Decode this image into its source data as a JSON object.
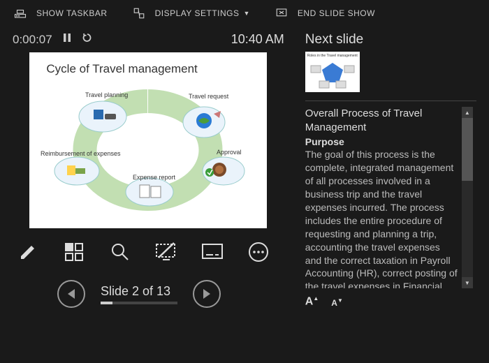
{
  "toolbar": {
    "show_taskbar": "SHOW TASKBAR",
    "display_settings": "DISPLAY SETTINGS",
    "end_slide_show": "END SLIDE SHOW"
  },
  "timer": {
    "elapsed": "0:00:07",
    "clock": "10:40 AM"
  },
  "slide": {
    "title": "Cycle of Travel management",
    "labels": {
      "travel_planning": "Travel planning",
      "travel_request": "Travel request",
      "approval": "Approval",
      "expense_report": "Expense report",
      "reimbursement": "Reimbursement of expenses"
    }
  },
  "nav": {
    "slide_label": "Slide 2 of 13",
    "current": 2,
    "total": 13
  },
  "next": {
    "heading": "Next slide",
    "thumb_title": "Roles in the Travel management"
  },
  "notes": {
    "title": "Overall Process of Travel Management",
    "purpose_label": "Purpose",
    "body": "The goal of this process is the complete, integrated management of all processes involved in a business trip and the travel expenses incurred. The process includes the entire procedure of requesting and planning a trip, accounting the travel expenses and the correct taxation in Payroll Accounting (HR), correct posting of the travel expenses in Financial"
  },
  "fontbuttons": {
    "increase": "A",
    "decrease": "A"
  }
}
